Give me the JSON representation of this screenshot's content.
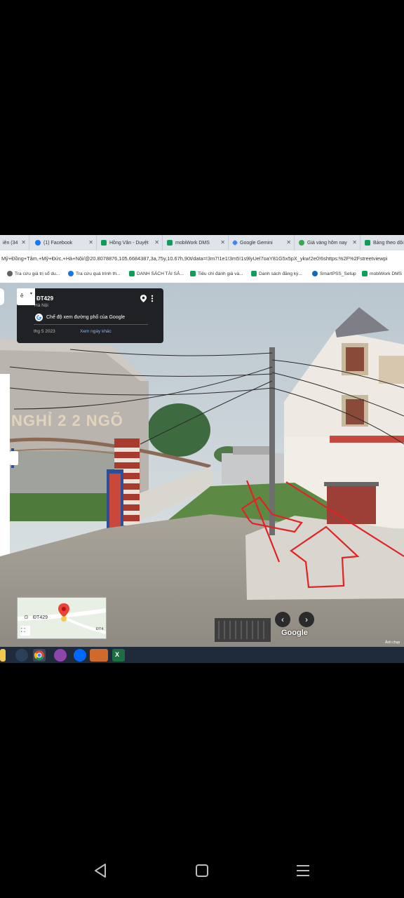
{
  "browser": {
    "tabs": [
      {
        "label": "iên (34",
        "icon": "generic-icon",
        "color": "#5f6368"
      },
      {
        "label": "(1) Facebook",
        "icon": "facebook-icon",
        "color": "#1877f2"
      },
      {
        "label": "Hồng Vân - Duyệt",
        "icon": "sheets-icon",
        "color": "#0f9d58"
      },
      {
        "label": "mobiWork DMS",
        "icon": "sheets-icon",
        "color": "#0f9d58"
      },
      {
        "label": "Google Gemini",
        "icon": "gemini-icon",
        "color": "#4285f4"
      },
      {
        "label": "Giá vàng hôm nay",
        "icon": "gold-icon",
        "color": "#34a853"
      },
      {
        "label": "Bảng theo dõi",
        "icon": "sheets-icon",
        "color": "#0f9d58"
      }
    ],
    "url": "Mỹ+Đồng+Tâm,+Mỹ+Đức,+Hà+Nội/@20.8078876,105.6684387,3a,75y,10.67h,90t/data=!3m7!1e1!3m5!1s9lyUel7oaY81G5x5pX_ykw!2e0!6shttps:%2F%2Fstreetviewpi",
    "bookmarks": [
      {
        "label": "Tra cứu giá trị sổ du...",
        "icon": "globe-icon",
        "color": "#1a73e8"
      },
      {
        "label": "Tra cứu quá trình th...",
        "icon": "globe-icon",
        "color": "#1a73e8"
      },
      {
        "label": "DANH SÁCH TÀI SẢ...",
        "icon": "sheets-icon",
        "color": "#0f9d58"
      },
      {
        "label": "Tiêu chí đánh giá và...",
        "icon": "sheets-icon",
        "color": "#0f9d58"
      },
      {
        "label": "Danh sách đăng ký...",
        "icon": "sheets-icon",
        "color": "#0f9d58"
      },
      {
        "label": "SmartPSS_Setup",
        "icon": "smartpss-icon",
        "color": "#1565c0"
      },
      {
        "label": "mobiWork DMS",
        "icon": "sheets-icon",
        "color": "#0f9d58"
      }
    ]
  },
  "street_view": {
    "location_title": "ĐT429",
    "location_sub": "Hà Nội",
    "mode_label": "Chế độ xem đường phố của Google",
    "date": "thg 5 2023",
    "other_dates_link": "Xem ngày khác",
    "back_glyph": "ê",
    "shop_sign": "NGHỈ 2 2 NGÕ",
    "minimap_road": "ĐT429",
    "minimap_label2": "ĐT4",
    "prev_glyph": "‹",
    "next_glyph": "›",
    "watermark": "Google",
    "credit": "Ảnh chụp"
  },
  "taskbar": {
    "apps": [
      "file-explorer-icon",
      "media-icon",
      "chrome-icon",
      "app-icon",
      "zalo-icon",
      "app-orange-icon",
      "excel-icon"
    ]
  },
  "android_nav": [
    "back-icon",
    "home-icon",
    "recents-icon"
  ]
}
